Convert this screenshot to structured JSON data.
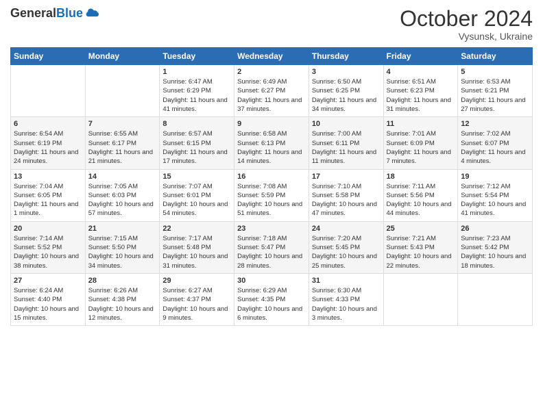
{
  "logo": {
    "line1": "General",
    "line2": "Blue"
  },
  "title": "October 2024",
  "subtitle": "Vysunsk, Ukraine",
  "days_header": [
    "Sunday",
    "Monday",
    "Tuesday",
    "Wednesday",
    "Thursday",
    "Friday",
    "Saturday"
  ],
  "rows": [
    [
      {
        "num": "",
        "info": ""
      },
      {
        "num": "",
        "info": ""
      },
      {
        "num": "1",
        "info": "Sunrise: 6:47 AM\nSunset: 6:29 PM\nDaylight: 11 hours and 41 minutes."
      },
      {
        "num": "2",
        "info": "Sunrise: 6:49 AM\nSunset: 6:27 PM\nDaylight: 11 hours and 37 minutes."
      },
      {
        "num": "3",
        "info": "Sunrise: 6:50 AM\nSunset: 6:25 PM\nDaylight: 11 hours and 34 minutes."
      },
      {
        "num": "4",
        "info": "Sunrise: 6:51 AM\nSunset: 6:23 PM\nDaylight: 11 hours and 31 minutes."
      },
      {
        "num": "5",
        "info": "Sunrise: 6:53 AM\nSunset: 6:21 PM\nDaylight: 11 hours and 27 minutes."
      }
    ],
    [
      {
        "num": "6",
        "info": "Sunrise: 6:54 AM\nSunset: 6:19 PM\nDaylight: 11 hours and 24 minutes."
      },
      {
        "num": "7",
        "info": "Sunrise: 6:55 AM\nSunset: 6:17 PM\nDaylight: 11 hours and 21 minutes."
      },
      {
        "num": "8",
        "info": "Sunrise: 6:57 AM\nSunset: 6:15 PM\nDaylight: 11 hours and 17 minutes."
      },
      {
        "num": "9",
        "info": "Sunrise: 6:58 AM\nSunset: 6:13 PM\nDaylight: 11 hours and 14 minutes."
      },
      {
        "num": "10",
        "info": "Sunrise: 7:00 AM\nSunset: 6:11 PM\nDaylight: 11 hours and 11 minutes."
      },
      {
        "num": "11",
        "info": "Sunrise: 7:01 AM\nSunset: 6:09 PM\nDaylight: 11 hours and 7 minutes."
      },
      {
        "num": "12",
        "info": "Sunrise: 7:02 AM\nSunset: 6:07 PM\nDaylight: 11 hours and 4 minutes."
      }
    ],
    [
      {
        "num": "13",
        "info": "Sunrise: 7:04 AM\nSunset: 6:05 PM\nDaylight: 11 hours and 1 minute."
      },
      {
        "num": "14",
        "info": "Sunrise: 7:05 AM\nSunset: 6:03 PM\nDaylight: 10 hours and 57 minutes."
      },
      {
        "num": "15",
        "info": "Sunrise: 7:07 AM\nSunset: 6:01 PM\nDaylight: 10 hours and 54 minutes."
      },
      {
        "num": "16",
        "info": "Sunrise: 7:08 AM\nSunset: 5:59 PM\nDaylight: 10 hours and 51 minutes."
      },
      {
        "num": "17",
        "info": "Sunrise: 7:10 AM\nSunset: 5:58 PM\nDaylight: 10 hours and 47 minutes."
      },
      {
        "num": "18",
        "info": "Sunrise: 7:11 AM\nSunset: 5:56 PM\nDaylight: 10 hours and 44 minutes."
      },
      {
        "num": "19",
        "info": "Sunrise: 7:12 AM\nSunset: 5:54 PM\nDaylight: 10 hours and 41 minutes."
      }
    ],
    [
      {
        "num": "20",
        "info": "Sunrise: 7:14 AM\nSunset: 5:52 PM\nDaylight: 10 hours and 38 minutes."
      },
      {
        "num": "21",
        "info": "Sunrise: 7:15 AM\nSunset: 5:50 PM\nDaylight: 10 hours and 34 minutes."
      },
      {
        "num": "22",
        "info": "Sunrise: 7:17 AM\nSunset: 5:48 PM\nDaylight: 10 hours and 31 minutes."
      },
      {
        "num": "23",
        "info": "Sunrise: 7:18 AM\nSunset: 5:47 PM\nDaylight: 10 hours and 28 minutes."
      },
      {
        "num": "24",
        "info": "Sunrise: 7:20 AM\nSunset: 5:45 PM\nDaylight: 10 hours and 25 minutes."
      },
      {
        "num": "25",
        "info": "Sunrise: 7:21 AM\nSunset: 5:43 PM\nDaylight: 10 hours and 22 minutes."
      },
      {
        "num": "26",
        "info": "Sunrise: 7:23 AM\nSunset: 5:42 PM\nDaylight: 10 hours and 18 minutes."
      }
    ],
    [
      {
        "num": "27",
        "info": "Sunrise: 6:24 AM\nSunset: 4:40 PM\nDaylight: 10 hours and 15 minutes."
      },
      {
        "num": "28",
        "info": "Sunrise: 6:26 AM\nSunset: 4:38 PM\nDaylight: 10 hours and 12 minutes."
      },
      {
        "num": "29",
        "info": "Sunrise: 6:27 AM\nSunset: 4:37 PM\nDaylight: 10 hours and 9 minutes."
      },
      {
        "num": "30",
        "info": "Sunrise: 6:29 AM\nSunset: 4:35 PM\nDaylight: 10 hours and 6 minutes."
      },
      {
        "num": "31",
        "info": "Sunrise: 6:30 AM\nSunset: 4:33 PM\nDaylight: 10 hours and 3 minutes."
      },
      {
        "num": "",
        "info": ""
      },
      {
        "num": "",
        "info": ""
      }
    ]
  ]
}
